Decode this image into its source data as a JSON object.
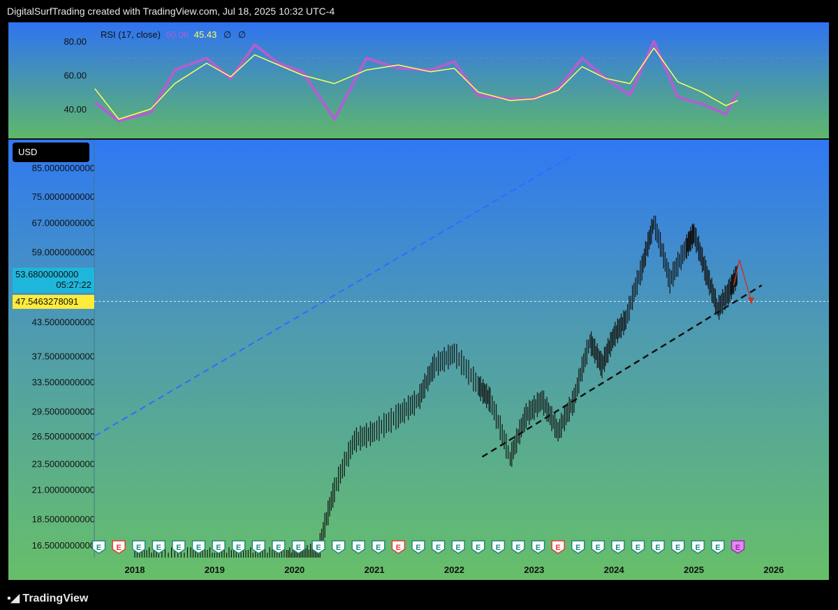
{
  "header": {
    "credit": "DigitalSurfTrading created with TradingView.com, Jul 18, 2025 10:32 UTC-4"
  },
  "footer": {
    "logo": "TradingView"
  },
  "rsi": {
    "legend_label": "RSI (17, close)",
    "value1": "50.06",
    "value2": "45.43",
    "value3": "∅",
    "value4": "∅",
    "ticks": [
      "80.00",
      "60.00",
      "40.00"
    ],
    "colors": {
      "rsi": "#b05fd1",
      "ma": "#ffff5a"
    }
  },
  "main": {
    "currency": "USD",
    "current_price": "53.6800000000",
    "countdown": "05:27:22",
    "line_value": "47.5463278091",
    "price_ticks": [
      "85.0000000000",
      "75.0000000000",
      "67.0000000000",
      "59.0000000000",
      "43.5000000000",
      "37.5000000000",
      "33.5000000000",
      "29.5000000000",
      "26.5000000000",
      "23.5000000000",
      "21.0000000000",
      "18.5000000000",
      "16.5000000000"
    ],
    "years": [
      "2018",
      "2019",
      "2020",
      "2021",
      "2022",
      "2023",
      "2024",
      "2025",
      "2026"
    ],
    "earnings_marker": "E"
  },
  "chart_data": [
    {
      "type": "line",
      "title": "RSI (17, close)",
      "ylim": [
        30,
        85
      ],
      "x": [
        2017.5,
        2017.8,
        2018.2,
        2018.5,
        2018.9,
        2019.2,
        2019.5,
        2019.8,
        2020.1,
        2020.5,
        2020.9,
        2021.3,
        2021.7,
        2022.0,
        2022.3,
        2022.7,
        2023.0,
        2023.3,
        2023.6,
        2023.9,
        2024.2,
        2024.5,
        2024.8,
        2025.1,
        2025.4,
        2025.55
      ],
      "series": [
        {
          "values": [
            44,
            33,
            38,
            63,
            70,
            58,
            78,
            67,
            62,
            34,
            70,
            64,
            63,
            68,
            48,
            46,
            46,
            52,
            70,
            58,
            48,
            80,
            47,
            43,
            37,
            50
          ]
        },
        {
          "values": [
            52,
            34,
            40,
            55,
            67,
            59,
            72,
            66,
            60,
            55,
            63,
            66,
            62,
            64,
            50,
            45,
            46,
            51,
            65,
            58,
            55,
            76,
            56,
            50,
            42,
            45
          ]
        }
      ]
    },
    {
      "type": "bar",
      "title": "",
      "ylim": [
        15.5,
        90
      ],
      "x": [
        2018.0,
        2018.3,
        2018.7,
        2019.0,
        2019.3,
        2019.6,
        2019.9,
        2020.1,
        2020.3,
        2020.5,
        2020.75,
        2021.0,
        2021.3,
        2021.55,
        2021.75,
        2022.0,
        2022.3,
        2022.45,
        2022.7,
        2022.9,
        2023.1,
        2023.3,
        2023.5,
        2023.7,
        2023.85,
        2024.0,
        2024.15,
        2024.35,
        2024.5,
        2024.7,
        2024.9,
        2025.0,
        2025.15,
        2025.3,
        2025.45,
        2025.55
      ],
      "values": [
        9,
        9.5,
        10,
        10.5,
        11,
        12,
        14,
        13,
        16,
        21,
        26,
        27,
        29,
        31,
        36,
        38,
        33,
        31,
        24,
        29,
        31,
        27,
        31,
        40,
        36,
        41,
        44,
        55,
        67,
        52,
        60,
        64,
        54,
        46,
        50,
        53.68
      ],
      "lines": [
        {
          "name": "dashed-blue",
          "x": [
            2017.5,
            2023.5
          ],
          "y": [
            26.5,
            90
          ]
        },
        {
          "name": "dashed-black",
          "x": [
            2022.35,
            2025.85
          ],
          "y": [
            24.2,
            51
          ]
        },
        {
          "name": "horizontal",
          "y": 47.5463278091
        }
      ]
    }
  ]
}
